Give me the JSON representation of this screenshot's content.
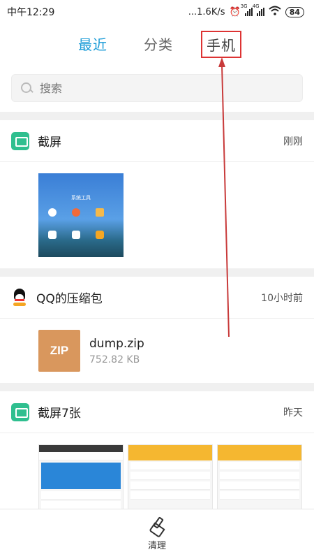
{
  "status_bar": {
    "time": "中午12:29",
    "speed": "...1.6K/s",
    "net_1": "3G",
    "net_2": "4G",
    "battery": "84"
  },
  "tabs": [
    {
      "label": "最近",
      "active": true
    },
    {
      "label": "分类",
      "active": false
    },
    {
      "label": "手机",
      "active": false
    }
  ],
  "search": {
    "placeholder": "搜索"
  },
  "sections": [
    {
      "title": "截屏",
      "time": "刚刚",
      "thumb_title": "系统工具"
    },
    {
      "title": "QQ的压缩包",
      "time": "10小时前",
      "file": {
        "icon_label": "ZIP",
        "name": "dump.zip",
        "size": "752.82 KB"
      }
    },
    {
      "title": "截屏7张",
      "time": "昨天"
    }
  ],
  "bottom": {
    "clean_label": "清理"
  },
  "colors": {
    "accent": "#1a9bd7",
    "highlight": "#d33333",
    "zip": "#d9975d",
    "green_icon": "#2fbf8f"
  }
}
